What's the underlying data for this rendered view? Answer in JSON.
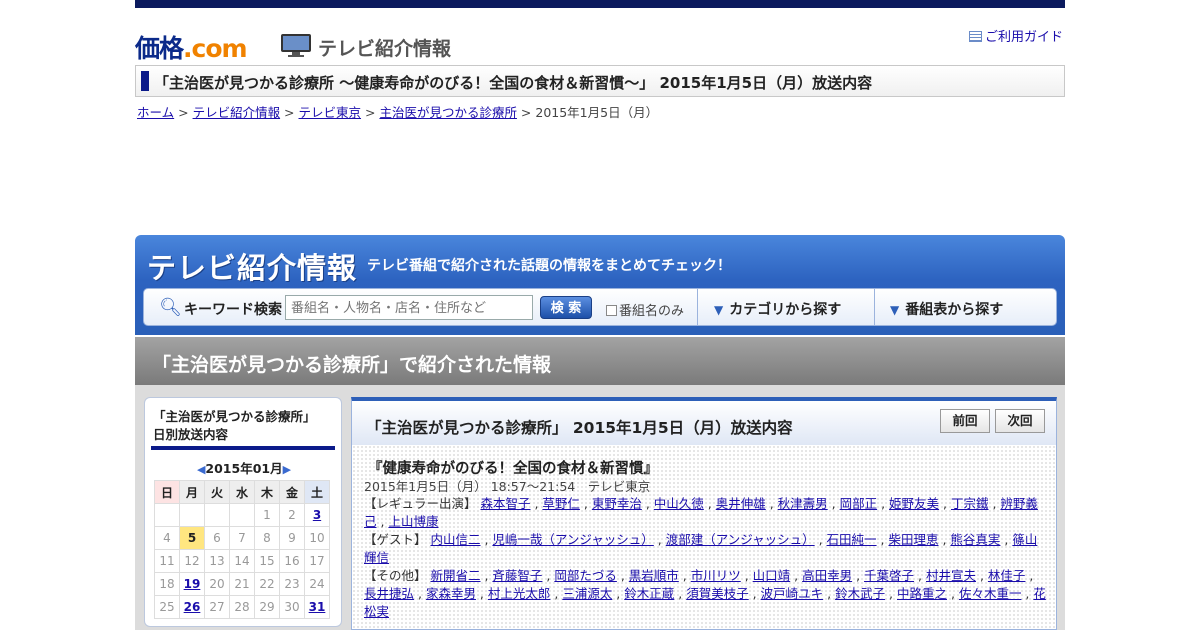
{
  "header": {
    "logo_main": "価格",
    "logo_suffix": ".com",
    "section_title": "テレビ紹介情報",
    "guide_link": "ご利用ガイド"
  },
  "page_title": "「主治医が見つかる診療所 ～健康寿命がのびる！全国の食材＆新習慣～」 2015年1月5日（月）放送内容",
  "breadcrumb": {
    "items": [
      "ホーム",
      "テレビ紹介情報",
      "テレビ東京",
      "主治医が見つかる診療所"
    ],
    "current": "2015年1月5日（月）",
    "sep": " > "
  },
  "banner": {
    "title": "テレビ紹介情報",
    "tagline": "テレビ番組で紹介された話題の情報をまとめてチェック！",
    "search_label": "キーワード検索",
    "search_placeholder": "番組名・人物名・店名・住所など",
    "search_button": "検 索",
    "checkbox_label": "番組名のみ",
    "category_link": "カテゴリから探す",
    "schedule_link": "番組表から探す"
  },
  "section_heading": "「主治医が見つかる診療所」で紹介された情報",
  "sidebar": {
    "title_line1": "「主治医が見つかる診療所」",
    "title_line2": "日別放送内容",
    "month": "2015年01月",
    "weekdays": [
      "日",
      "月",
      "火",
      "水",
      "木",
      "金",
      "土"
    ],
    "weeks": [
      [
        "",
        "",
        "",
        "",
        "1",
        "2",
        "3"
      ],
      [
        "4",
        "5",
        "6",
        "7",
        "8",
        "9",
        "10"
      ],
      [
        "11",
        "12",
        "13",
        "14",
        "15",
        "16",
        "17"
      ],
      [
        "18",
        "19",
        "20",
        "21",
        "22",
        "23",
        "24"
      ],
      [
        "25",
        "26",
        "27",
        "28",
        "29",
        "30",
        "31"
      ]
    ],
    "linked_days": [
      "3",
      "19",
      "26",
      "31"
    ],
    "highlight_day": "5"
  },
  "main": {
    "heading": "「主治医が見つかる診療所」 2015年1月5日（月）放送内容",
    "prev_button": "前回",
    "next_button": "次回",
    "program_title": "『健康寿命がのびる！全国の食材＆新習慣』",
    "broadcast_info": "2015年1月5日（月） 18:57～21:54　テレビ東京",
    "regular_label": "【レギュラー出演】",
    "regulars": [
      "森本智子",
      "草野仁",
      "東野幸治",
      "中山久徳",
      "奥井伸雄",
      "秋津壽男",
      "岡部正",
      "姫野友美",
      "丁宗鐵",
      "辨野義己",
      "上山博康"
    ],
    "guest_label": "【ゲスト】",
    "guests": [
      "内山信二",
      "児嶋一哉（アンジャッシュ）",
      "渡部建（アンジャッシュ）",
      "石田純一",
      "柴田理恵",
      "熊谷真実",
      "篠山輝信"
    ],
    "other_label": "【その他】",
    "others": [
      "新開省二",
      "斉藤智子",
      "岡部たづる",
      "黒岩順市",
      "市川リツ",
      "山口靖",
      "高田幸男",
      "千葉啓子",
      "村井宣夫",
      "林佳子",
      "長井捷弘",
      "家森幸男",
      "村上光太郎",
      "三浦源太",
      "鈴木正蔵",
      "須賀美枝子",
      "波戸崎ユキ",
      "鈴木武子",
      "中路重之",
      "佐々木重一",
      "花松実"
    ]
  }
}
